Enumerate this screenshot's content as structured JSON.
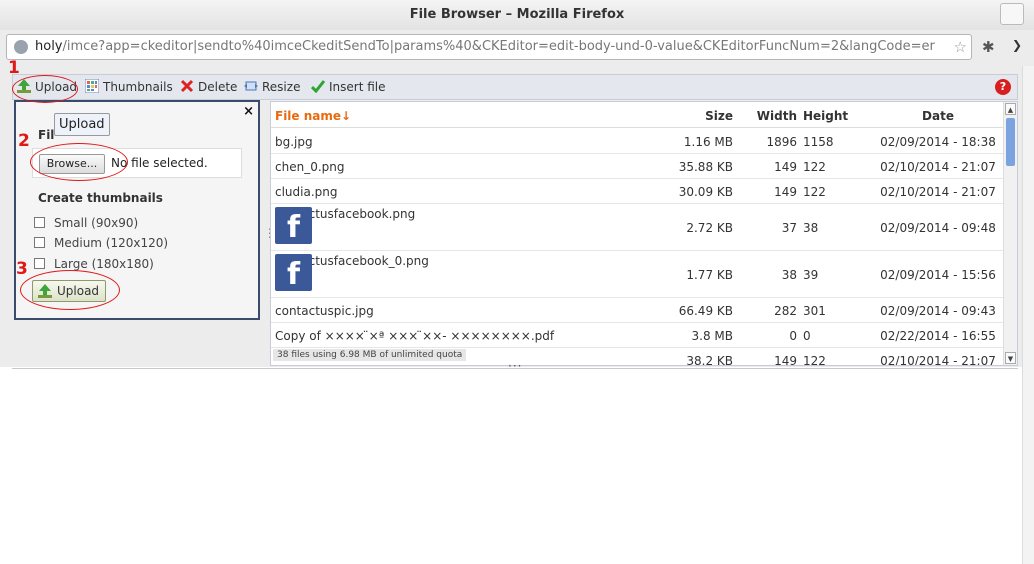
{
  "window": {
    "title": "File Browser – Mozilla Firefox"
  },
  "url": {
    "host": "holy",
    "path": "/imce?app=ckeditor|sendto%40imceCkeditSendTo|params%40&CKEditor=edit-body-und-0-value&CKEditorFuncNum=2&langCode=er"
  },
  "toolbar": {
    "upload_label": "Upload",
    "thumbnails_label": "Thumbnails",
    "delete_label": "Delete",
    "resize_label": "Resize",
    "insert_label": "Insert file",
    "help_glyph": "?"
  },
  "upload_panel": {
    "tooltip": "Upload",
    "file_label": "Fil",
    "browse_label": "Browse...",
    "no_file_text": "No file selected.",
    "thumbnails_title": "Create thumbnails",
    "options": [
      "Small (90x90)",
      "Medium (120x120)",
      "Large (180x180)"
    ],
    "upload_button": "Upload",
    "close_glyph": "×"
  },
  "file_table": {
    "headers": {
      "name": "File name↓",
      "size": "Size",
      "width": "Width",
      "height": "Height",
      "date": "Date"
    },
    "rows": [
      {
        "name": "bg.jpg",
        "size": "1.16 MB",
        "width": "1896",
        "height": "1158",
        "date": "02/09/2014 - 18:38",
        "thumb": false
      },
      {
        "name": "chen_0.png",
        "size": "35.88 KB",
        "width": "149",
        "height": "122",
        "date": "02/10/2014 - 21:07",
        "thumb": false
      },
      {
        "name": "cludia.png",
        "size": "30.09 KB",
        "width": "149",
        "height": "122",
        "date": "02/10/2014 - 21:07",
        "thumb": false
      },
      {
        "name": "contactusfacebook.png",
        "size": "2.72 KB",
        "width": "37",
        "height": "38",
        "date": "02/09/2014 - 09:48",
        "thumb": true
      },
      {
        "name": "contactusfacebook_0.png",
        "size": "1.77 KB",
        "width": "38",
        "height": "39",
        "date": "02/09/2014 - 15:56",
        "thumb": true
      },
      {
        "name": "contactuspic.jpg",
        "size": "66.49 KB",
        "width": "282",
        "height": "301",
        "date": "02/09/2014 - 09:43",
        "thumb": false
      },
      {
        "name": "Copy of ×××× ̈×ª ××× ̈××- ××××××××.pdf",
        "size": "3.8 MB",
        "width": "0",
        "height": "0",
        "date": "02/22/2014 - 16:55",
        "thumb": false
      },
      {
        "name": "",
        "size": "38.2 KB",
        "width": "149",
        "height": "122",
        "date": "02/10/2014 - 21:07",
        "thumb": false
      }
    ],
    "status": "38 files using 6.98 MB of unlimited quota"
  },
  "annotations": [
    "1",
    "2",
    "3"
  ],
  "colors": {
    "accent_orange": "#e86a0e",
    "annotation_red": "#e01818",
    "facebook_blue": "#3b5998"
  }
}
